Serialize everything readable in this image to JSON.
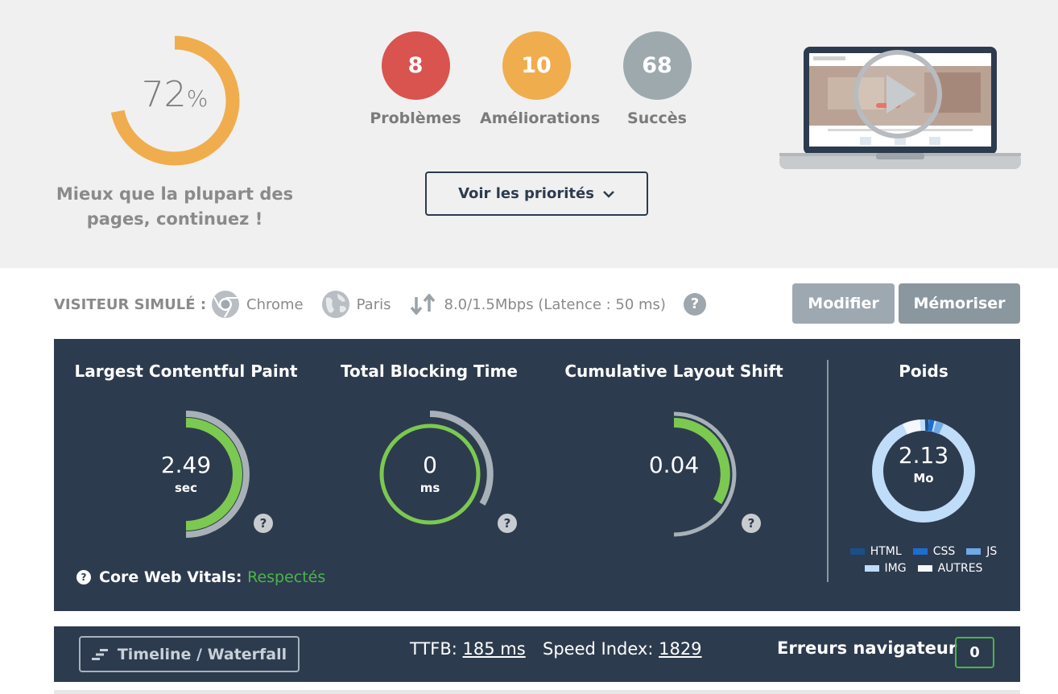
{
  "score": {
    "value": "72",
    "unit": "%",
    "fraction": 0.72,
    "color": "#f0ad4e",
    "caption": "Mieux que la plupart des pages, continuez !"
  },
  "stats": [
    {
      "value": "8",
      "label": "Problèmes",
      "color": "#d9534f"
    },
    {
      "value": "10",
      "label": "Améliorations",
      "color": "#f0ad4e"
    },
    {
      "value": "68",
      "label": "Succès",
      "color": "#9ea9ae"
    }
  ],
  "priorities_button": {
    "label": "Voir les priorités",
    "icon": "chevron-down-icon"
  },
  "video_preview": {
    "icon": "play-icon"
  },
  "simulated_visitor": {
    "label": "VISITEUR SIMULÉ :",
    "browser": {
      "label": "Chrome",
      "icon": "chrome-icon"
    },
    "location": {
      "label": "Paris",
      "icon": "globe-icon"
    },
    "connection": {
      "label": "8.0/1.5Mbps (Latence : 50 ms)",
      "icon": "up-down-arrows-icon"
    },
    "help": "?"
  },
  "buttons": {
    "modify": "Modifier",
    "save": "Mémoriser"
  },
  "metrics": {
    "lcp": {
      "title": "Largest Contentful Paint",
      "value": "2.49",
      "unit": "sec",
      "fraction": 0.5,
      "help": "?"
    },
    "tbt": {
      "title": "Total Blocking Time",
      "value": "0",
      "unit": "ms",
      "fraction": 1.0,
      "help": "?"
    },
    "cls": {
      "title": "Cumulative Layout Shift",
      "value": "0.04",
      "unit": "",
      "fraction": 0.33,
      "help": "?"
    },
    "weight": {
      "title": "Poids",
      "value": "2.13",
      "unit": "Mo",
      "legend": [
        {
          "label": "HTML",
          "color": "#1a4f8a"
        },
        {
          "label": "CSS",
          "color": "#1c6fd1"
        },
        {
          "label": "JS",
          "color": "#6fa9e8"
        },
        {
          "label": "IMG",
          "color": "#bfdcf9"
        },
        {
          "label": "AUTRES",
          "color": "#f4f7fb"
        }
      ]
    }
  },
  "core_web_vitals": {
    "label": "Core Web Vitals:",
    "status": "Respectés",
    "status_color": "#4ab54a",
    "help": "?"
  },
  "bottom_bar": {
    "timeline_button": "Timeline / Waterfall",
    "ttfb_label": "TTFB:",
    "ttfb_value": "185 ms",
    "speed_index_label": "Speed Index:",
    "speed_index_value": "1829",
    "errors_label": "Erreurs navigateur",
    "errors_count": "0"
  }
}
